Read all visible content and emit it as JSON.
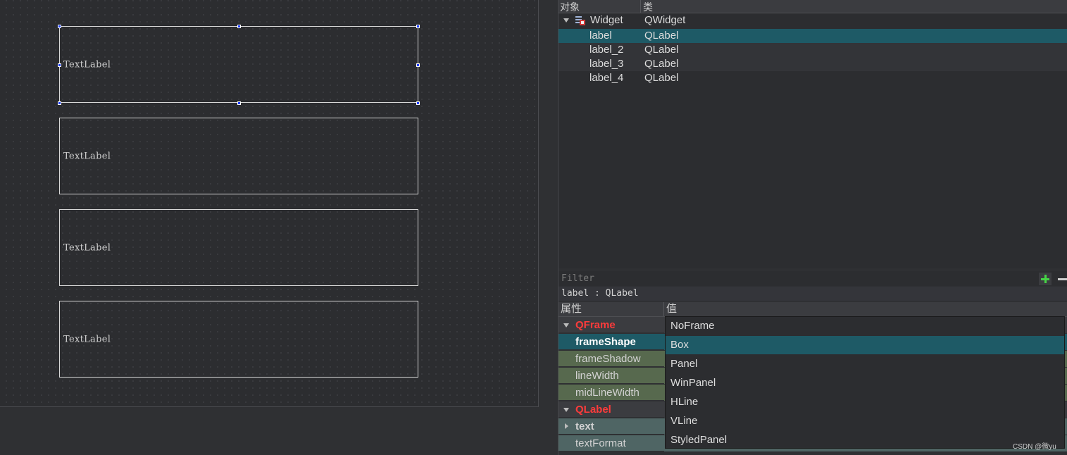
{
  "canvas": {
    "labels": [
      "TextLabel",
      "TextLabel",
      "TextLabel",
      "TextLabel"
    ]
  },
  "object_inspector": {
    "header": {
      "object_col": "对象",
      "class_col": "类"
    },
    "root": {
      "name": "Widget",
      "class": "QWidget"
    },
    "children": [
      {
        "name": "label",
        "class": "QLabel",
        "selected": true
      },
      {
        "name": "label_2",
        "class": "QLabel"
      },
      {
        "name": "label_3",
        "class": "QLabel"
      },
      {
        "name": "label_4",
        "class": "QLabel"
      }
    ]
  },
  "property_editor": {
    "filter_placeholder": "Filter",
    "object_class": "label : QLabel",
    "header": {
      "property_col": "属性",
      "value_col": "值"
    },
    "rows": [
      {
        "name": "QFrame",
        "kind": "group"
      },
      {
        "name": "frameShape",
        "kind": "selected"
      },
      {
        "name": "frameShadow",
        "kind": "property"
      },
      {
        "name": "lineWidth",
        "kind": "property"
      },
      {
        "name": "midLineWidth",
        "kind": "property"
      },
      {
        "name": "QLabel",
        "kind": "group"
      },
      {
        "name": "text",
        "kind": "expandable"
      },
      {
        "name": "textFormat",
        "kind": "property"
      }
    ],
    "frame_shape_options": [
      "NoFrame",
      "Box",
      "Panel",
      "WinPanel",
      "HLine",
      "VLine",
      "StyledPanel"
    ],
    "frame_shape_selected": "Box"
  },
  "watermark": "CSDN @微yu",
  "colors": {
    "selection": "#1e5a66",
    "group_text": "#ff3b3b",
    "modified_property": "#57694e",
    "add_icon": "#46d446"
  }
}
